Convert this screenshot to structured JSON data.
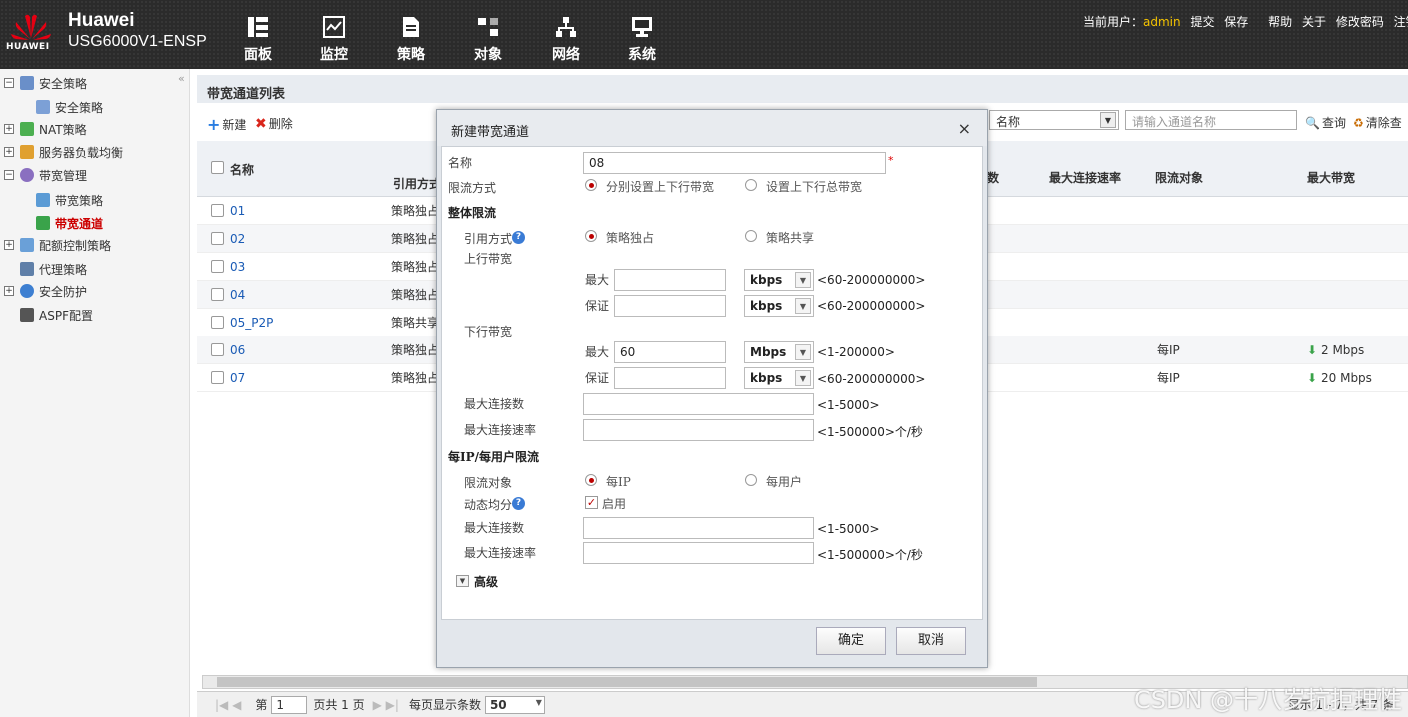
{
  "brand": {
    "name": "Huawei",
    "model": "USG6000V1-ENSP",
    "logo_text": "HUAWEI"
  },
  "nav": [
    {
      "label": "面板",
      "icon": "dashboard-icon"
    },
    {
      "label": "监控",
      "icon": "monitor-icon"
    },
    {
      "label": "策略",
      "icon": "policy-icon"
    },
    {
      "label": "对象",
      "icon": "object-icon"
    },
    {
      "label": "网络",
      "icon": "network-icon"
    },
    {
      "label": "系统",
      "icon": "system-icon"
    }
  ],
  "usermenu": {
    "current_user_label": "当前用户：",
    "user": "admin",
    "submit": "提交",
    "save": "保存",
    "help": "帮助",
    "about": "关于",
    "change_pwd": "修改密码",
    "logout": "注销"
  },
  "sidebar": {
    "items": [
      {
        "label": "安全策略",
        "toggle": "−"
      },
      {
        "label": "安全策略"
      },
      {
        "label": "NAT策略",
        "toggle": "+"
      },
      {
        "label": "服务器负载均衡",
        "toggle": "+"
      },
      {
        "label": "带宽管理",
        "toggle": "−"
      },
      {
        "label": "带宽策略"
      },
      {
        "label": "带宽通道"
      },
      {
        "label": "配额控制策略",
        "toggle": "+"
      },
      {
        "label": "代理策略"
      },
      {
        "label": "安全防护",
        "toggle": "+"
      },
      {
        "label": "ASPF配置"
      }
    ],
    "collapse": "«"
  },
  "main": {
    "title": "带宽通道列表",
    "toolbar": {
      "new": "新建",
      "delete": "删除",
      "filter_field": "名称",
      "search_placeholder": "请输入通道名称",
      "query": "查询",
      "clear": "清除查"
    },
    "columns": {
      "name": "名称",
      "ref": "引用方式",
      "conn": "数",
      "max_rate": "最大连接速率",
      "target": "限流对象",
      "max_bw": "最大带宽"
    },
    "rows": [
      {
        "name": "01",
        "ref": "策略独占",
        "target": "",
        "bw": ""
      },
      {
        "name": "02",
        "ref": "策略独占",
        "target": "",
        "bw": ""
      },
      {
        "name": "03",
        "ref": "策略独占",
        "target": "",
        "bw": ""
      },
      {
        "name": "04",
        "ref": "策略独占",
        "target": "",
        "bw": ""
      },
      {
        "name": "05_P2P",
        "ref": "策略共享",
        "target": "",
        "bw": ""
      },
      {
        "name": "06",
        "ref": "策略独占",
        "target": "每IP",
        "bw": "2 Mbps"
      },
      {
        "name": "07",
        "ref": "策略独占",
        "target": "每IP",
        "bw": "20 Mbps"
      }
    ],
    "pager": {
      "page_label": "第",
      "page_value": "1",
      "page_total": "页共 1 页",
      "per_page_label": "每页显示条数",
      "per_page_value": "50",
      "summary": "显示 1 - 7，共 7 条"
    }
  },
  "dialog": {
    "title": "新建带宽通道",
    "close": "×",
    "name_label": "名称",
    "name_value": "08",
    "required_mark": "*",
    "limit_mode_label": "限流方式",
    "limit_mode_opt1": "分别设置上下行带宽",
    "limit_mode_opt2": "设置上下行总带宽",
    "overall_section": "整体限流",
    "ref_label": "引用方式",
    "ref_opt1": "策略独占",
    "ref_opt2": "策略共享",
    "up_label": "上行带宽",
    "down_label": "下行带宽",
    "max_label": "最大",
    "guar_label": "保证",
    "up_max_value": "",
    "up_max_unit": "kbps",
    "up_max_hint": "<60-200000000>",
    "up_guar_value": "",
    "up_guar_unit": "kbps",
    "up_guar_hint": "<60-200000000>",
    "down_max_value": "60",
    "down_max_unit": "Mbps",
    "down_max_hint": "<1-200000>",
    "down_guar_value": "",
    "down_guar_unit": "kbps",
    "down_guar_hint": "<60-200000000>",
    "max_conn_label": "最大连接数",
    "max_conn_hint": "<1-5000>",
    "max_rate_label": "最大连接速率",
    "max_rate_hint": "<1-500000>个/秒",
    "perip_section": "每IP/每用户限流",
    "target_label": "限流对象",
    "target_opt1": "每IP",
    "target_opt2": "每用户",
    "dyn_label": "动态均分",
    "dyn_check_label": "启用",
    "perip_conn_label": "最大连接数",
    "perip_conn_hint": "<1-5000>",
    "perip_rate_label": "最大连接速率",
    "perip_rate_hint": "<1-500000>个/秒",
    "advanced": "高级",
    "ok": "确定",
    "cancel": "取消"
  },
  "watermark": "CSDN @十八岁抗拒理性"
}
